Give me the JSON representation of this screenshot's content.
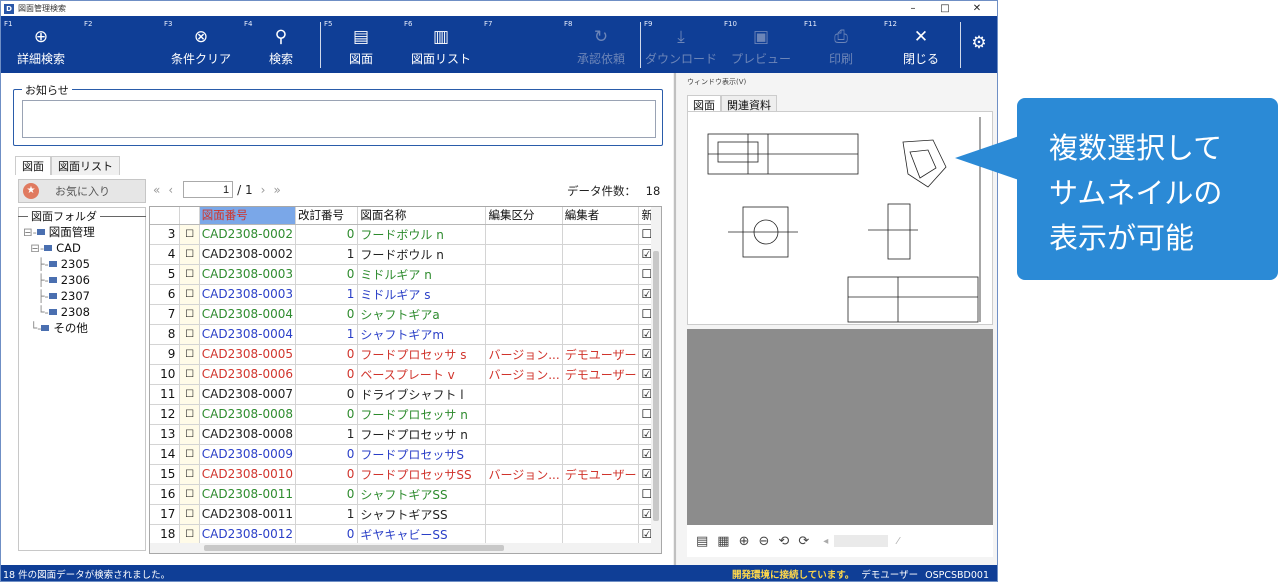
{
  "window": {
    "title": "図面管理検索",
    "min": "–",
    "max": "□",
    "close": "✕"
  },
  "toolbar": [
    {
      "fkey": "F1",
      "label": "詳細検索",
      "icon": "⊕",
      "enabled": true
    },
    {
      "fkey": "F2",
      "label": "",
      "icon": "",
      "enabled": true
    },
    {
      "fkey": "F3",
      "label": "条件クリア",
      "icon": "⊗",
      "enabled": true
    },
    {
      "fkey": "F4",
      "label": "検索",
      "icon": "⚲",
      "enabled": true
    },
    {
      "fkey": "F5",
      "label": "図面",
      "icon": "▤",
      "enabled": true
    },
    {
      "fkey": "F6",
      "label": "図面リスト",
      "icon": "▥",
      "enabled": true
    },
    {
      "fkey": "F7",
      "label": "",
      "icon": "",
      "enabled": true
    },
    {
      "fkey": "F8",
      "label": "承認依頼",
      "icon": "↻",
      "enabled": false
    },
    {
      "fkey": "F9",
      "label": "ダウンロード",
      "icon": "⤓",
      "enabled": false
    },
    {
      "fkey": "F10",
      "label": "プレビュー",
      "icon": "▣",
      "enabled": false
    },
    {
      "fkey": "F11",
      "label": "印刷",
      "icon": "⎙",
      "enabled": false
    },
    {
      "fkey": "F12",
      "label": "閉じる",
      "icon": "✕",
      "enabled": true
    }
  ],
  "settings_icon": "⚙",
  "notice": {
    "legend": "お知らせ",
    "text": ""
  },
  "left_tabs": [
    "図面",
    "図面リスト"
  ],
  "favorites_label": "お気に入り",
  "folder": {
    "header": "図面フォルダ",
    "items": [
      {
        "label": "図面管理",
        "prefix": "⊟-"
      },
      {
        "label": "CAD",
        "prefix": "  ⊟-"
      },
      {
        "label": "2305",
        "prefix": "    ├-"
      },
      {
        "label": "2306",
        "prefix": "    ├-"
      },
      {
        "label": "2307",
        "prefix": "    ├-"
      },
      {
        "label": "2308",
        "prefix": "    └-"
      },
      {
        "label": "その他",
        "prefix": "  └-"
      }
    ]
  },
  "pager": {
    "first": "«",
    "prev": "‹",
    "page": "1",
    "of": "/ 1",
    "next": "›",
    "last": "»"
  },
  "count": {
    "label": "データ件数：",
    "value": "18"
  },
  "grid": {
    "columns": [
      "",
      "",
      "図面番号",
      "改訂番号",
      "図面名称",
      "編集区分",
      "編集者",
      "新"
    ],
    "rows": [
      {
        "n": "3",
        "cb": "☐",
        "no": "CAD2308-0002",
        "rev": "0",
        "name": "フードボウル n",
        "kubun": "",
        "editor": "",
        "new": "☐",
        "color": "green"
      },
      {
        "n": "4",
        "cb": "☐",
        "no": "CAD2308-0002",
        "rev": "1",
        "name": "フードボウル n",
        "kubun": "",
        "editor": "",
        "new": "☑",
        "color": "black"
      },
      {
        "n": "5",
        "cb": "☐",
        "no": "CAD2308-0003",
        "rev": "0",
        "name": "ミドルギア n",
        "kubun": "",
        "editor": "",
        "new": "☐",
        "color": "green"
      },
      {
        "n": "6",
        "cb": "☐",
        "no": "CAD2308-0003",
        "rev": "1",
        "name": "ミドルギア s",
        "kubun": "",
        "editor": "",
        "new": "☑",
        "color": "blue"
      },
      {
        "n": "7",
        "cb": "☐",
        "no": "CAD2308-0004",
        "rev": "0",
        "name": "シャフトギアa",
        "kubun": "",
        "editor": "",
        "new": "☐",
        "color": "green"
      },
      {
        "n": "8",
        "cb": "☐",
        "no": "CAD2308-0004",
        "rev": "1",
        "name": "シャフトギアm",
        "kubun": "",
        "editor": "",
        "new": "☑",
        "color": "blue"
      },
      {
        "n": "9",
        "cb": "☐",
        "no": "CAD2308-0005",
        "rev": "0",
        "name": "フードプロセッサ s",
        "kubun": "バージョン...",
        "editor": "デモユーザー",
        "new": "☑",
        "color": "red"
      },
      {
        "n": "10",
        "cb": "☐",
        "no": "CAD2308-0006",
        "rev": "0",
        "name": "ベースプレート v",
        "kubun": "バージョン...",
        "editor": "デモユーザー",
        "new": "☑",
        "color": "red"
      },
      {
        "n": "11",
        "cb": "☐",
        "no": "CAD2308-0007",
        "rev": "0",
        "name": "ドライブシャフト l",
        "kubun": "",
        "editor": "",
        "new": "☑",
        "color": "black"
      },
      {
        "n": "12",
        "cb": "☐",
        "no": "CAD2308-0008",
        "rev": "0",
        "name": "フードプロセッサ n",
        "kubun": "",
        "editor": "",
        "new": "☐",
        "color": "green"
      },
      {
        "n": "13",
        "cb": "☐",
        "no": "CAD2308-0008",
        "rev": "1",
        "name": "フードプロセッサ n",
        "kubun": "",
        "editor": "",
        "new": "☑",
        "color": "black"
      },
      {
        "n": "14",
        "cb": "☐",
        "no": "CAD2308-0009",
        "rev": "0",
        "name": "フードプロセッサS",
        "kubun": "",
        "editor": "",
        "new": "☑",
        "color": "blue"
      },
      {
        "n": "15",
        "cb": "☐",
        "no": "CAD2308-0010",
        "rev": "0",
        "name": "フードプロセッサSS",
        "kubun": "バージョン...",
        "editor": "デモユーザー",
        "new": "☑",
        "color": "red"
      },
      {
        "n": "16",
        "cb": "☐",
        "no": "CAD2308-0011",
        "rev": "0",
        "name": "シャフトギアSS",
        "kubun": "",
        "editor": "",
        "new": "☐",
        "color": "green"
      },
      {
        "n": "17",
        "cb": "☐",
        "no": "CAD2308-0011",
        "rev": "1",
        "name": "シャフトギアSS",
        "kubun": "",
        "editor": "",
        "new": "☑",
        "color": "black"
      },
      {
        "n": "18",
        "cb": "☐",
        "no": "CAD2308-0012",
        "rev": "0",
        "name": "ギヤキャビーSS",
        "kubun": "",
        "editor": "",
        "new": "☑",
        "color": "blue",
        "current": true
      }
    ]
  },
  "right": {
    "title": "ウィンドウ表示(V)",
    "tabs": [
      "図面",
      "関連資料"
    ]
  },
  "image_tools": [
    "▤",
    "▦",
    "⊕",
    "⊖",
    "⟲",
    "⟳",
    "◂",
    "⁄"
  ],
  "status": {
    "left": "18 件の図面データが検索されました。",
    "connection": "開発環境に接続しています。",
    "user": "デモユーザー",
    "code": "OSPCSBD001"
  },
  "callout": {
    "text": "複数選択して\nサムネイルの\n表示が可能"
  },
  "colors": {
    "toolbar": "#0f3e96",
    "callout": "#2b8ad6",
    "green": "#2e8b2e",
    "blue": "#2a3fc7",
    "red": "#d0342c"
  }
}
